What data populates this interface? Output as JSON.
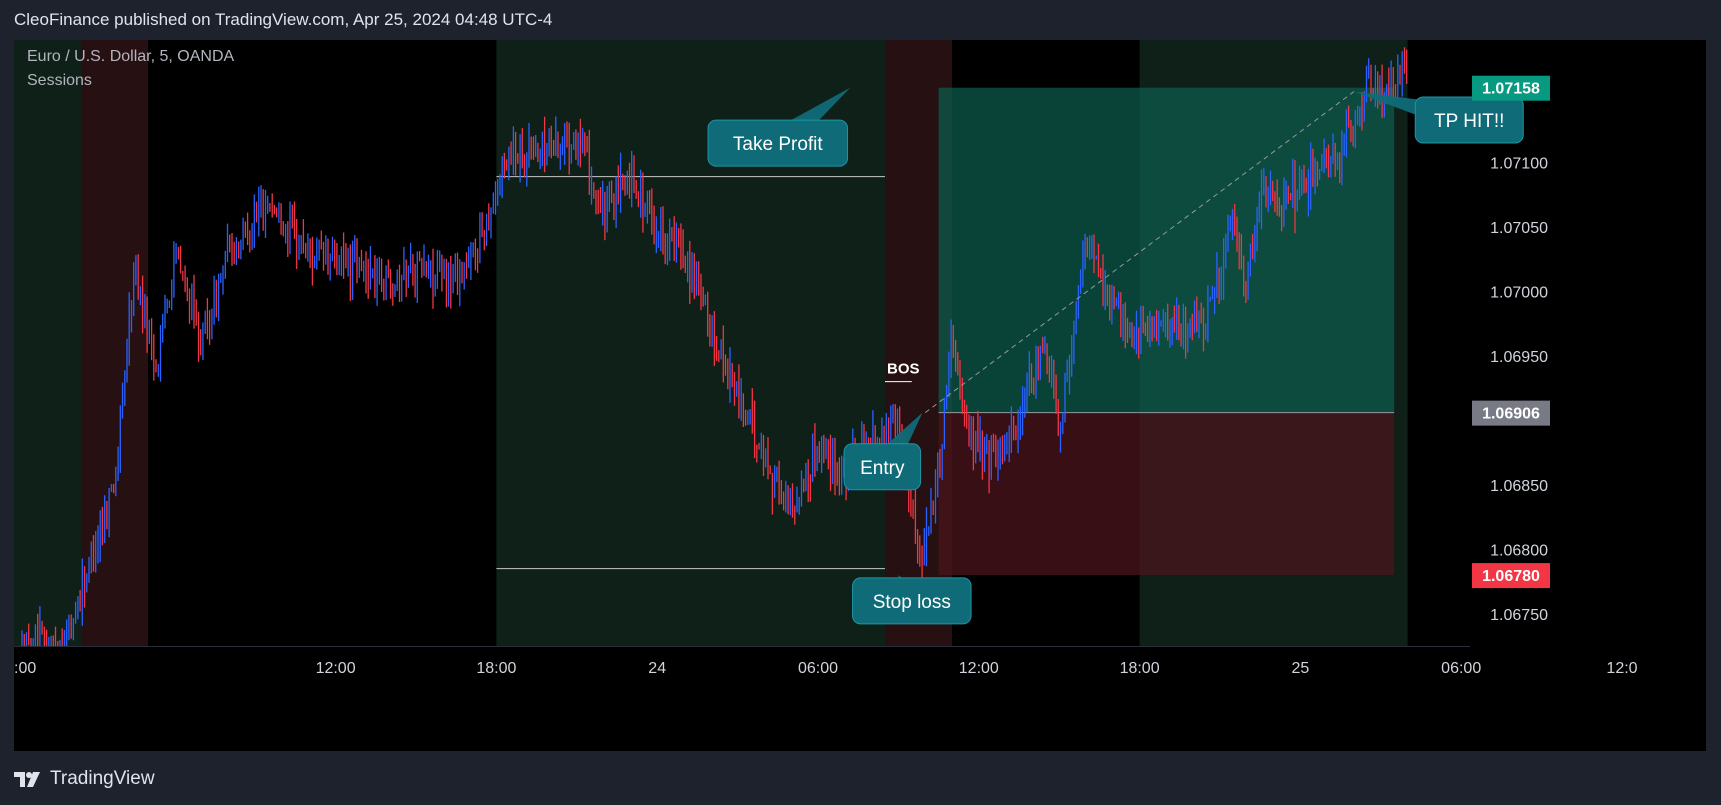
{
  "header": {
    "text": "CleoFinance published on TradingView.com, Apr 25, 2024 04:48 UTC-4"
  },
  "footer": {
    "brand": "TradingView",
    "logo_icon": "tradingview-logo-icon"
  },
  "chart_title": {
    "symbol": "Euro / U.S. Dollar, 5, OANDA",
    "indicator": "Sessions"
  },
  "colors": {
    "background": "#000000",
    "frame": "#1e222d",
    "candle_up": "#2962ff",
    "candle_down": "#f23645",
    "profit_zone": "#0c5a4a",
    "loss_zone": "#4a141c",
    "label_fill": "#0f6b78",
    "tag_tp": "#089981",
    "tag_entry": "#787b86",
    "tag_sl": "#f23645"
  },
  "chart_data": {
    "type": "candlestick",
    "title": "Euro / U.S. Dollar, 5, OANDA",
    "ylim": [
      1.06725,
      1.07195
    ],
    "y_ticks": [
      "1.07100",
      "1.07050",
      "1.07000",
      "1.06950",
      "1.06850",
      "1.06800",
      "1.06750"
    ],
    "y_tick_values": [
      1.071,
      1.0705,
      1.07,
      1.0695,
      1.0685,
      1.068,
      1.0675
    ],
    "x_range_hours": [
      0,
      84
    ],
    "x_ticks": [
      {
        "label": ":00",
        "hour": 0
      },
      {
        "label": "12:00",
        "hour": 12
      },
      {
        "label": "18:00",
        "hour": 18
      },
      {
        "label": "24",
        "hour": 24
      },
      {
        "label": "06:00",
        "hour": 30
      },
      {
        "label": "12:00",
        "hour": 36
      },
      {
        "label": "18:00",
        "hour": 42
      },
      {
        "label": "25",
        "hour": 48
      },
      {
        "label": "06:00",
        "hour": 54
      },
      {
        "label": "12:0",
        "hour": 60
      }
    ],
    "price_path": [
      [
        0.3,
        1.0672
      ],
      [
        2.0,
        1.0673
      ],
      [
        3.8,
        1.0686
      ],
      [
        4.5,
        1.0702
      ],
      [
        5.3,
        1.0694
      ],
      [
        6.0,
        1.0703
      ],
      [
        7.0,
        1.0696
      ],
      [
        8.0,
        1.0703
      ],
      [
        9.5,
        1.0707
      ],
      [
        11.0,
        1.0703
      ],
      [
        12.5,
        1.0702
      ],
      [
        14.0,
        1.0701
      ],
      [
        15.0,
        1.0702
      ],
      [
        16.0,
        1.0701
      ],
      [
        17.0,
        1.0702
      ],
      [
        18.5,
        1.0711
      ],
      [
        19.5,
        1.0711
      ],
      [
        21.0,
        1.0712
      ],
      [
        22.0,
        1.0706
      ],
      [
        23.0,
        1.0709
      ],
      [
        24.0,
        1.0705
      ],
      [
        25.0,
        1.0703
      ],
      [
        26.0,
        1.0697
      ],
      [
        27.0,
        1.0692
      ],
      [
        28.0,
        1.0687
      ],
      [
        29.0,
        1.0683
      ],
      [
        30.0,
        1.0688
      ],
      [
        31.0,
        1.0686
      ],
      [
        32.0,
        1.0688
      ],
      [
        33.0,
        1.069
      ],
      [
        33.8,
        1.0679
      ],
      [
        34.5,
        1.0686
      ],
      [
        35.0,
        1.0697
      ],
      [
        35.6,
        1.0689
      ],
      [
        36.5,
        1.0687
      ],
      [
        37.5,
        1.069
      ],
      [
        38.5,
        1.0696
      ],
      [
        39.0,
        1.069
      ],
      [
        39.5,
        1.0696
      ],
      [
        40.0,
        1.0704
      ],
      [
        40.8,
        1.07
      ],
      [
        41.5,
        1.0697
      ],
      [
        43.0,
        1.0697
      ],
      [
        44.5,
        1.0698
      ],
      [
        45.5,
        1.0705
      ],
      [
        46.0,
        1.07
      ],
      [
        46.5,
        1.0708
      ],
      [
        47.5,
        1.0707
      ],
      [
        48.5,
        1.0709
      ],
      [
        49.5,
        1.0711
      ],
      [
        50.0,
        1.0713
      ],
      [
        50.5,
        1.0716
      ],
      [
        51.2,
        1.0715
      ],
      [
        52.0,
        1.0718
      ]
    ],
    "sessions": [
      {
        "start": -1.0,
        "end": 2.5,
        "color": "green"
      },
      {
        "start": 2.5,
        "end": 5.0,
        "color": "red"
      },
      {
        "start": 18.0,
        "end": 32.5,
        "color": "green"
      },
      {
        "start": 32.5,
        "end": 35.0,
        "color": "red"
      },
      {
        "start": 42.0,
        "end": 52.0,
        "color": "green"
      }
    ],
    "position": {
      "entry": 1.06906,
      "take_profit": 1.07158,
      "stop_loss": 1.0678,
      "start_hour": 34.5,
      "end_hour": 51.5
    },
    "bos": {
      "label": "BOS",
      "price": 1.0693,
      "start_hour": 32.5,
      "end_hour": 33.5
    },
    "range_levels": [
      {
        "price": 1.07089,
        "start_hour": 18.0,
        "end_hour": 32.5
      },
      {
        "price": 1.06785,
        "start_hour": 18.0,
        "end_hour": 32.5
      }
    ],
    "price_tags": [
      {
        "text": "1.07158",
        "price": 1.07158,
        "kind": "tp"
      },
      {
        "text": "1.06906",
        "price": 1.06906,
        "kind": "entry"
      },
      {
        "text": "1.06780",
        "price": 1.0678,
        "kind": "sl"
      }
    ],
    "annotations": [
      {
        "text": "Take Profit",
        "hour": 28.5,
        "price": 1.07115,
        "pointer_hour": 31.2,
        "pointer_price": 1.07158
      },
      {
        "text": "TP HIT!!",
        "hour": 54.3,
        "price": 1.07133,
        "pointer_hour": 50.0,
        "pointer_price": 1.07155
      },
      {
        "text": "Entry",
        "hour": 32.4,
        "price": 1.06864,
        "pointer_hour": 33.9,
        "pointer_price": 1.06906
      },
      {
        "text": "Stop loss",
        "hour": 33.5,
        "price": 1.0676,
        "pointer_hour": 33.0,
        "pointer_price": 1.0678
      }
    ]
  }
}
